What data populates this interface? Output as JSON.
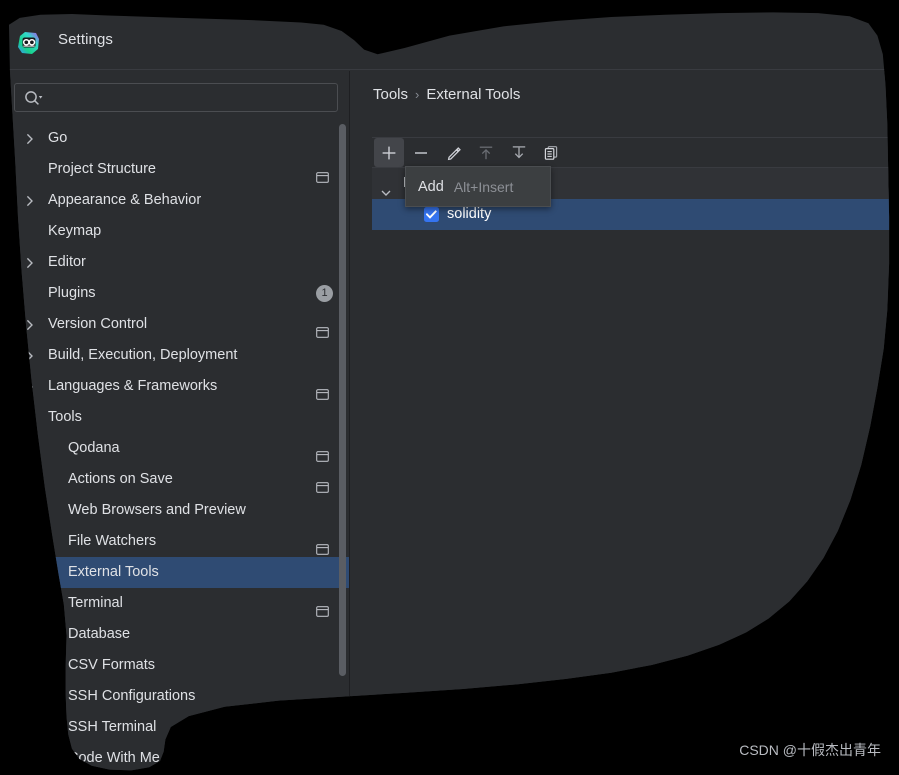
{
  "window": {
    "title": "Settings",
    "app_icon": "goland-icon"
  },
  "search": {
    "value": "",
    "placeholder": "",
    "icon": "search-icon"
  },
  "sidebar": {
    "items": [
      {
        "label": "Go",
        "level": 0,
        "arrow": "right",
        "marker": "none",
        "selected": false
      },
      {
        "label": "Project Structure",
        "level": 0,
        "arrow": "none",
        "marker": "module",
        "selected": false
      },
      {
        "label": "Appearance & Behavior",
        "level": 0,
        "arrow": "right",
        "marker": "none",
        "selected": false
      },
      {
        "label": "Keymap",
        "level": 0,
        "arrow": "none",
        "marker": "none",
        "selected": false
      },
      {
        "label": "Editor",
        "level": 0,
        "arrow": "right",
        "marker": "none",
        "selected": false
      },
      {
        "label": "Plugins",
        "level": 0,
        "arrow": "none",
        "marker": "badge",
        "badge": "1",
        "selected": false
      },
      {
        "label": "Version Control",
        "level": 0,
        "arrow": "right",
        "marker": "module",
        "selected": false
      },
      {
        "label": "Build, Execution, Deployment",
        "level": 0,
        "arrow": "right",
        "marker": "none",
        "selected": false
      },
      {
        "label": "Languages & Frameworks",
        "level": 0,
        "arrow": "right",
        "marker": "module",
        "selected": false
      },
      {
        "label": "Tools",
        "level": 0,
        "arrow": "down",
        "marker": "none",
        "selected": false
      },
      {
        "label": "Qodana",
        "level": 1,
        "arrow": "none",
        "marker": "module",
        "selected": false
      },
      {
        "label": "Actions on Save",
        "level": 1,
        "arrow": "none",
        "marker": "module",
        "selected": false
      },
      {
        "label": "Web Browsers and Preview",
        "level": 1,
        "arrow": "none",
        "marker": "none",
        "selected": false
      },
      {
        "label": "File Watchers",
        "level": 1,
        "arrow": "none",
        "marker": "module",
        "selected": false
      },
      {
        "label": "External Tools",
        "level": 1,
        "arrow": "none",
        "marker": "none",
        "selected": true
      },
      {
        "label": "Terminal",
        "level": 1,
        "arrow": "none",
        "marker": "module",
        "selected": false
      },
      {
        "label": "Database",
        "level": 1,
        "arrow": "right",
        "marker": "none",
        "selected": false
      },
      {
        "label": "CSV Formats",
        "level": 1,
        "arrow": "none",
        "marker": "none",
        "selected": false
      },
      {
        "label": "SSH Configurations",
        "level": 1,
        "arrow": "none",
        "marker": "module",
        "selected": false
      },
      {
        "label": "SSH Terminal",
        "level": 1,
        "arrow": "none",
        "marker": "none",
        "selected": false
      },
      {
        "label": "Code With Me",
        "level": 1,
        "arrow": "none",
        "marker": "none",
        "selected": false
      }
    ]
  },
  "content": {
    "breadcrumb": {
      "parent": "Tools",
      "separator": "›",
      "current": "External Tools"
    },
    "toolbar": {
      "buttons": [
        {
          "name": "add-button",
          "icon": "plus-icon",
          "enabled": true,
          "hovered": true
        },
        {
          "name": "remove-button",
          "icon": "minus-icon",
          "enabled": true,
          "hovered": false
        },
        {
          "name": "edit-button",
          "icon": "pencil-icon",
          "enabled": true,
          "hovered": false
        },
        {
          "name": "move-up-button",
          "icon": "arrow-up-icon",
          "enabled": false,
          "hovered": false
        },
        {
          "name": "move-down-button",
          "icon": "arrow-down-icon",
          "enabled": true,
          "hovered": false
        },
        {
          "name": "copy-button",
          "icon": "copy-icon",
          "enabled": true,
          "hovered": false
        }
      ]
    },
    "tool_tree": {
      "group": {
        "label": "External Tools",
        "expanded": true
      },
      "children": [
        {
          "label": "solidity",
          "checked": true,
          "selected": true
        }
      ]
    }
  },
  "tooltip": {
    "title": "Add",
    "shortcut": "Alt+Insert"
  },
  "watermark": {
    "text": "CSDN @十假杰出青年"
  },
  "colors": {
    "background": "#2b2d30",
    "selection": "#2f4b73",
    "checkbox": "#3574f0",
    "text": "#dfe1e5",
    "muted": "#8d9096",
    "separator": "#393b40",
    "tooltip_bg": "#3c3f41",
    "badge_bg": "#9a9ea3"
  }
}
